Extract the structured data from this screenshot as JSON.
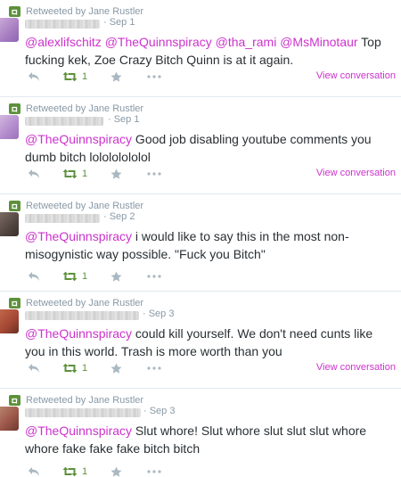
{
  "colors": {
    "mention": "#cc33cc",
    "retweet_green": "#5c913b",
    "muted_text": "#8899a6",
    "divider": "#e1e8ed",
    "action_gray": "#aab8c2"
  },
  "icons": {
    "context": "retweet-badge-icon",
    "reply": "reply-icon",
    "retweet": "retweet-icon",
    "favorite": "star-icon",
    "more": "more-dots-icon"
  },
  "tweets": [
    {
      "context": "Retweeted by Jane Rustler",
      "time": "· Sep 1",
      "mentions": [
        "@alexlifschitz",
        "@TheQuinnspiracy",
        "@tha_rami",
        "@MsMinotaur"
      ],
      "text": " Top fucking kek, Zoe Crazy Bitch Quinn is at it again.",
      "retweet_count": "1",
      "view_conversation": "View conversation"
    },
    {
      "context": "Retweeted by Jane Rustler",
      "time": "· Sep 1",
      "mentions": [
        "@TheQuinnspiracy"
      ],
      "text": " Good job disabling youtube comments you dumb bitch lolololololol",
      "retweet_count": "1",
      "view_conversation": "View conversation"
    },
    {
      "context": "Retweeted by Jane Rustler",
      "time": "· Sep 2",
      "mentions": [
        "@TheQuinnspiracy"
      ],
      "text": " i would like to say this in the most non-misogynistic way possible. \"Fuck you Bitch\"",
      "retweet_count": "1",
      "view_conversation": ""
    },
    {
      "context": "Retweeted by Jane Rustler",
      "time": "· Sep 3",
      "mentions": [
        "@TheQuinnspiracy"
      ],
      "text": " could kill yourself. We don't need cunts like you in this world. Trash is more worth than you",
      "retweet_count": "1",
      "view_conversation": "View conversation"
    },
    {
      "context": "Retweeted by Jane Rustler",
      "time": "· Sep 3",
      "mentions": [
        "@TheQuinnspiracy"
      ],
      "text": " Slut whore! Slut whore slut slut slut whore whore fake fake fake bitch bitch",
      "retweet_count": "1",
      "view_conversation": ""
    }
  ]
}
